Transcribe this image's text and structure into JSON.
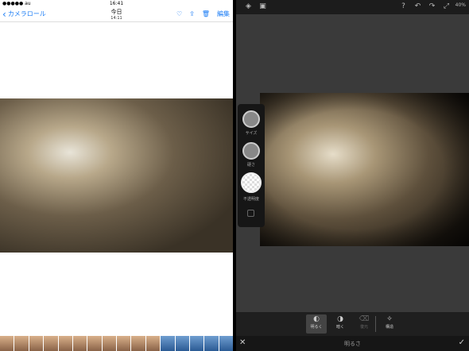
{
  "left": {
    "status": {
      "carrier": "●●●●● au",
      "time": "16:41"
    },
    "nav": {
      "back_label": "カメラロール",
      "title": "今日",
      "subtitle": "14:11",
      "edit_label": "編集"
    },
    "icons": [
      "chevron-left-icon",
      "heart-icon",
      "share-icon",
      "trash-icon"
    ]
  },
  "right": {
    "status": {
      "battery": "40%"
    },
    "panel": {
      "size_label": "サイズ",
      "hardness_label": "硬さ",
      "opacity_label": "不透明度"
    },
    "toolbar": [
      {
        "label": "明るく",
        "icon": "brighten-icon",
        "active": true
      },
      {
        "label": "暗く",
        "icon": "darken-icon",
        "active": false
      },
      {
        "label": "復元",
        "icon": "restore-icon",
        "active": false,
        "disabled": true
      },
      {
        "label": "構造",
        "icon": "structure-icon",
        "active": false
      }
    ],
    "bottom": {
      "title": "明るさ"
    },
    "colors": {
      "accent": "#1a7cf5",
      "panel_bg": "#161616",
      "canvas_bg": "#3a3a3a"
    }
  }
}
